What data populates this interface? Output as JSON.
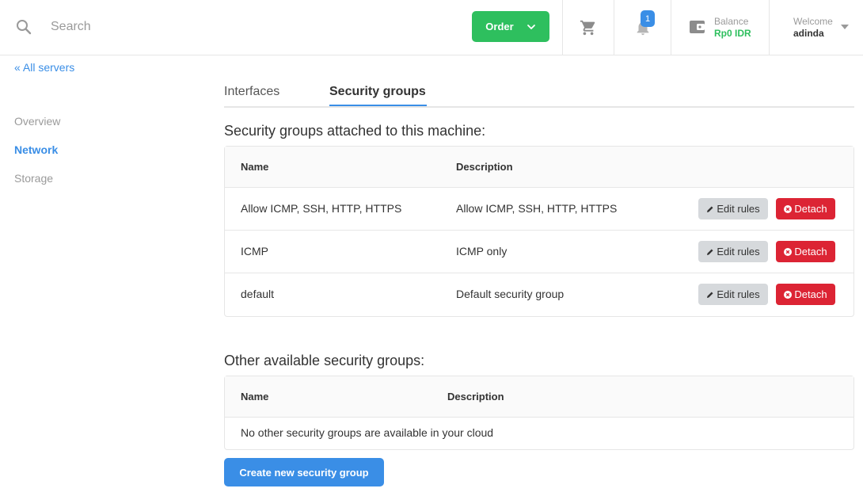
{
  "header": {
    "search_placeholder": "Search",
    "order_label": "Order",
    "notification_count": "1",
    "balance_label": "Balance",
    "balance_value": "Rp0 IDR",
    "welcome_label": "Welcome",
    "username": "adinda"
  },
  "sidebar": {
    "back_link": "« All servers",
    "items": [
      {
        "label": "Overview",
        "active": false
      },
      {
        "label": "Network",
        "active": true
      },
      {
        "label": "Storage",
        "active": false
      }
    ]
  },
  "tabs": [
    {
      "label": "Interfaces",
      "active": false
    },
    {
      "label": "Security groups",
      "active": true
    }
  ],
  "attached": {
    "title": "Security groups attached to this machine:",
    "columns": [
      "Name",
      "Description"
    ],
    "rows": [
      {
        "name": "Allow ICMP, SSH, HTTP, HTTPS",
        "description": "Allow ICMP, SSH, HTTP, HTTPS"
      },
      {
        "name": "ICMP",
        "description": "ICMP only"
      },
      {
        "name": "default",
        "description": "Default security group"
      }
    ],
    "edit_label": "Edit rules",
    "detach_label": "Detach"
  },
  "available": {
    "title": "Other available security groups:",
    "columns": [
      "Name",
      "Description"
    ],
    "empty_message": "No other security groups are available in your cloud"
  },
  "create_button": "Create new security group",
  "colors": {
    "accent": "#3a8ee6",
    "success": "#2ebf5e",
    "danger": "#dc2434"
  },
  "icons": [
    "search-icon",
    "chevron-down-icon",
    "cart-icon",
    "bell-icon",
    "wallet-icon",
    "caret-down-icon",
    "pencil-icon",
    "close-circle-icon"
  ]
}
